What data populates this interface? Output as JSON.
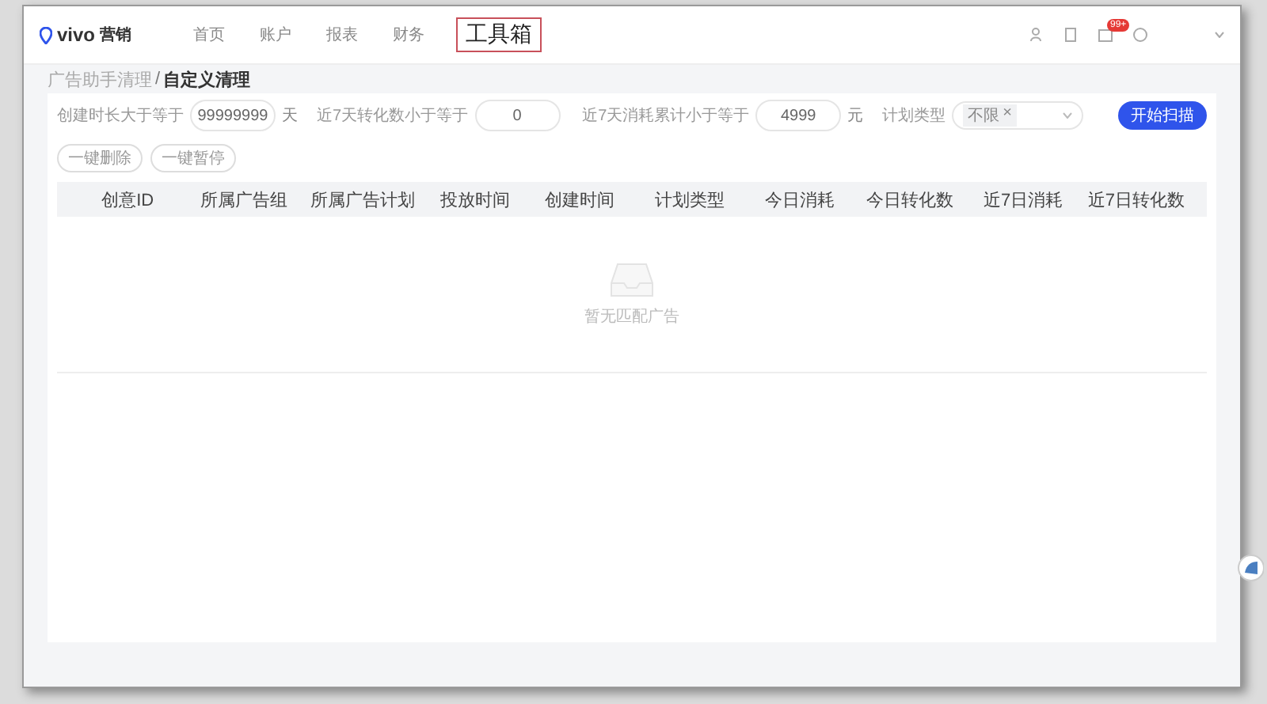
{
  "header": {
    "logo": "vivo",
    "brand": "营销",
    "nav": [
      {
        "label": "首页",
        "selected": false
      },
      {
        "label": "账户",
        "selected": false
      },
      {
        "label": "报表",
        "selected": false
      },
      {
        "label": "财务",
        "selected": false
      },
      {
        "label": "工具箱",
        "selected": true
      }
    ],
    "badge": "99+"
  },
  "breadcrumb": [
    {
      "label": "广告助手清理",
      "current": false
    },
    {
      "label": "自定义清理",
      "current": true
    }
  ],
  "breadcrumb_separator": "/",
  "filters": [
    {
      "label": "创建时长大于等于",
      "value": "99999999",
      "unit": "天"
    },
    {
      "label": "近7天转化数小于等于",
      "value": "0"
    },
    {
      "label": "近7天消耗累计小于等于",
      "value": "4999",
      "unit": "元"
    }
  ],
  "plan_type": {
    "label": "计划类型",
    "tag": "不限",
    "tag_close": "×"
  },
  "scan_button": "开始扫描",
  "bulk_buttons": [
    "一键删除",
    "一键暂停"
  ],
  "table": {
    "columns": [
      "创意ID",
      "所属广告组",
      "所属广告计划",
      "投放时间",
      "创建时间",
      "计划类型",
      "今日消耗",
      "今日转化数",
      "近7日消耗",
      "近7日转化数"
    ],
    "empty_text": "暂无匹配广告"
  }
}
